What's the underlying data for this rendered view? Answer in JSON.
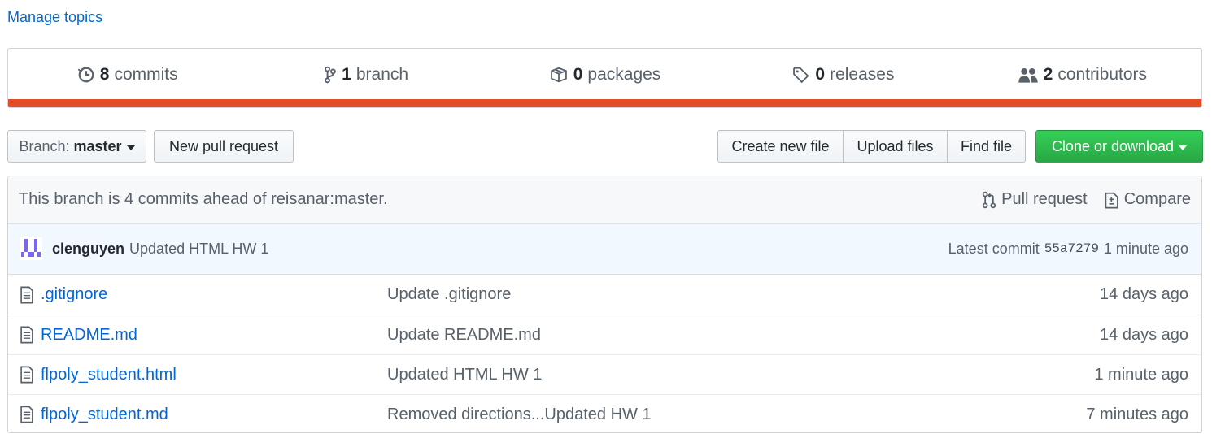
{
  "topics": {
    "manage_label": "Manage topics"
  },
  "summary": {
    "commits": {
      "count": "8",
      "label": "commits"
    },
    "branch": {
      "count": "1",
      "label": "branch"
    },
    "packages": {
      "count": "0",
      "label": "packages"
    },
    "releases": {
      "count": "0",
      "label": "releases"
    },
    "contributors": {
      "count": "2",
      "label": "contributors"
    },
    "language_color": "#e34c26"
  },
  "toolbar": {
    "branch_prefix": "Branch:",
    "branch_name": "master",
    "new_pr_label": "New pull request",
    "create_file_label": "Create new file",
    "upload_label": "Upload files",
    "find_label": "Find file",
    "clone_label": "Clone or download"
  },
  "ahead": {
    "message": "This branch is 4 commits ahead of reisanar:master.",
    "pull_request_label": "Pull request",
    "compare_label": "Compare"
  },
  "latest_commit": {
    "author": "clenguyen",
    "message": "Updated HTML HW 1",
    "prefix": "Latest commit",
    "sha": "55a7279",
    "age": "1 minute ago"
  },
  "files": [
    {
      "name": ".gitignore",
      "message": "Update .gitignore",
      "age": "14 days ago"
    },
    {
      "name": "README.md",
      "message": "Update README.md",
      "age": "14 days ago"
    },
    {
      "name": "flpoly_student.html",
      "message": "Updated HTML HW 1",
      "age": "1 minute ago"
    },
    {
      "name": "flpoly_student.md",
      "message": "Removed directions...Updated HW 1",
      "age": "7 minutes ago"
    }
  ]
}
